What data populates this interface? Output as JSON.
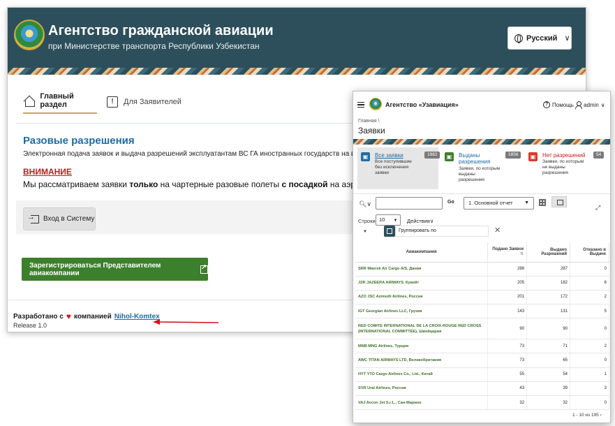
{
  "back_window": {
    "title": "Агентство гражданской авиации",
    "subtitle": "при Министерстве транспорта Республики Узбекистан",
    "language_button": "Русский",
    "tabs": [
      {
        "label": "Главный раздел"
      },
      {
        "label": "Для Заявителей"
      }
    ],
    "announcement": {
      "title": "Разовые разрешения",
      "description": "Электронная подача заявок и выдача разрешений эксплуатантам ВС ГА иностранных государств на выпол",
      "attention_label": "ВНИМАНИЕ",
      "attention_text_1": "Мы рассматриваем заявки ",
      "attention_bold_1": "только",
      "attention_text_2": " на чартерные разовые полеты ",
      "attention_bold_2": "с посадкой",
      "attention_text_3": " на аэродромы ГА"
    },
    "login_button": "Вход в Систему",
    "register_button": "Зарегистрироваться Представителем авиакомпании",
    "footer": {
      "developed_by": "Разработано с",
      "by_company": "компанией",
      "company_link": "Nihol-Komtex",
      "release": "Release 1.0"
    }
  },
  "front_window": {
    "app_title": "Агентство «Узавиация»",
    "help_label": "Помощь",
    "user_label": "admin",
    "breadcrumb": "Главная \\",
    "page_title": "Заявки",
    "cards": [
      {
        "label": "Все заявки",
        "description": "Все поступившие без исключения заявки",
        "count": "1982",
        "icon_color": "#1f6fa8",
        "icon": "inbox-icon"
      },
      {
        "label": "Выданы разрешения",
        "description": "Заявки, по которым выданы разрешения",
        "count": "1856",
        "icon_color": "#3c7f2c",
        "icon": "approved-icon"
      },
      {
        "label": "Нет разрешений",
        "description": "Заявки, по которым не выданы разрешения",
        "count": "54",
        "icon_color": "#d83a2a",
        "icon": "denied-icon"
      }
    ],
    "toolbar": {
      "go_label": "Go",
      "report_select": "1. Основной отчет",
      "rows_label": "Строки",
      "rows_value": "10",
      "actions_label": "Действия"
    },
    "group_by_label": "Группировать по",
    "table": {
      "headers": [
        "Авиакомпания",
        "Подано Заявок",
        "Выдано Разрешений",
        "Отказано в Выдаче"
      ],
      "rows": [
        {
          "airline": "SRR Maersk Air Cargo A/S, Дания",
          "submitted": "288",
          "issued": "287",
          "refused": "0"
        },
        {
          "airline": "JZR JAZEERA AIRWAYS, Кувейт",
          "submitted": "205",
          "issued": "182",
          "refused": "6"
        },
        {
          "airline": "AZO JSC Azimuth Airlines, Россия",
          "submitted": "201",
          "issued": "172",
          "refused": "2"
        },
        {
          "airline": "IGT Georgian Airlines LLC, Грузия",
          "submitted": "143",
          "issued": "131",
          "refused": "5"
        },
        {
          "airline": "RED COMITE INTERNATIONAL DE LA CROIX-ROUGE RED CROSS (INTERNATIONAL COMMITTEE), Швейцария",
          "submitted": "90",
          "issued": "90",
          "refused": "0"
        },
        {
          "airline": "MNB MNG Airlines, Турция",
          "submitted": "73",
          "issued": "71",
          "refused": "2"
        },
        {
          "airline": "AWC TITAN AIRWAYS LTD, Великобритания",
          "submitted": "73",
          "issued": "65",
          "refused": "0"
        },
        {
          "airline": "HYT YTO Cargo Airlines Co., Ltd., Китай",
          "submitted": "55",
          "issued": "54",
          "refused": "1"
        },
        {
          "airline": "SVR Ural Airlines, Россия",
          "submitted": "43",
          "issued": "39",
          "refused": "3"
        },
        {
          "airline": "VAJ Avcon Jet S.r.L., Сан-Марино",
          "submitted": "32",
          "issued": "32",
          "refused": "0"
        }
      ]
    },
    "pager": "1 - 10 из 195"
  }
}
